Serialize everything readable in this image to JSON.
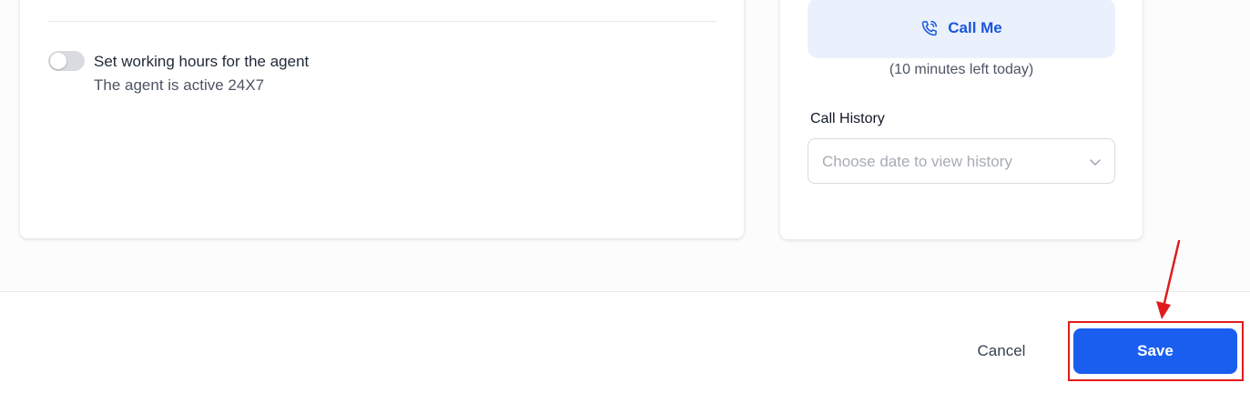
{
  "working_hours": {
    "title": "Set working hours for the agent",
    "subtitle": "The agent is active 24X7",
    "toggle_on": false
  },
  "call_panel": {
    "call_button_label": "Call Me",
    "call_icon": "phone-call-icon",
    "minutes_left": "(10 minutes left today)",
    "history_label": "Call History",
    "history_placeholder": "Choose date to view history",
    "dropdown_icon": "chevron-down-icon"
  },
  "footer": {
    "cancel_label": "Cancel",
    "save_label": "Save"
  },
  "colors": {
    "accent": "#1a5ef0",
    "call_button_bg": "#ebf1fc",
    "highlight": "#e01b1b"
  }
}
